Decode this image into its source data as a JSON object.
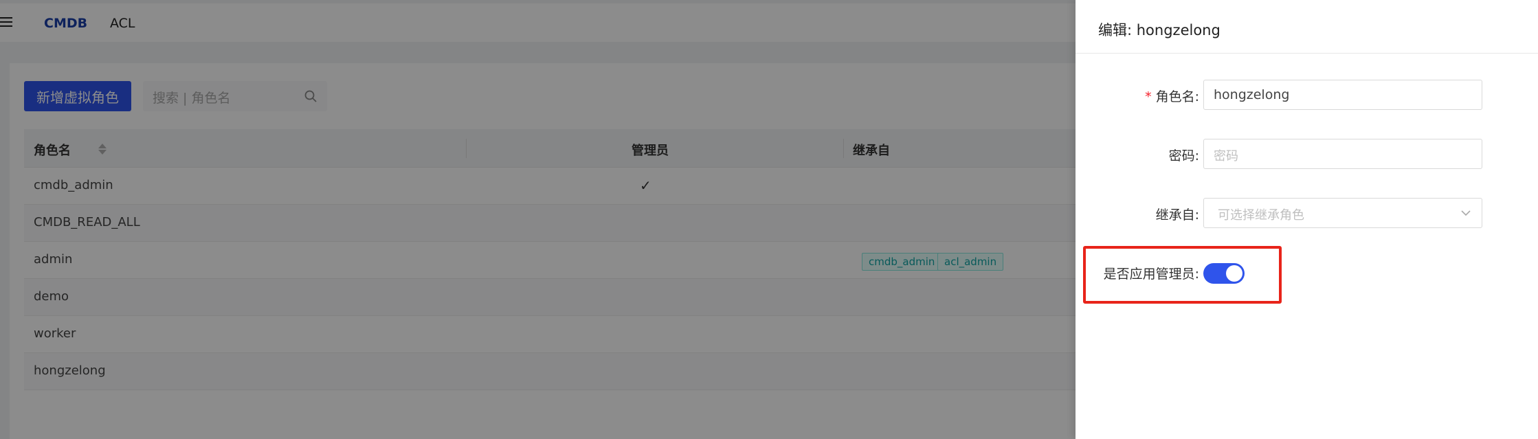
{
  "nav": {
    "items": [
      "CMDB",
      "ACL"
    ]
  },
  "toolbar": {
    "add_button": "新增虚拟角色",
    "search_placeholder": "搜索 | 角色名"
  },
  "table": {
    "headers": {
      "name": "角色名",
      "admin": "管理员",
      "inherit": "继承自"
    },
    "rows": [
      {
        "name": "cmdb_admin",
        "admin": "✓",
        "tags": []
      },
      {
        "name": "CMDB_READ_ALL",
        "admin": "",
        "tags": []
      },
      {
        "name": "admin",
        "admin": "",
        "tags": [
          "cmdb_admin",
          "acl_admin"
        ]
      },
      {
        "name": "demo",
        "admin": "",
        "tags": []
      },
      {
        "name": "worker",
        "admin": "",
        "tags": []
      },
      {
        "name": "hongzelong",
        "admin": "",
        "tags": []
      }
    ]
  },
  "drawer": {
    "title": "编辑: hongzelong",
    "fields": {
      "role_name": {
        "label": "角色名:",
        "value": "hongzelong",
        "required": "*"
      },
      "password": {
        "label": "密码:",
        "placeholder": "密码"
      },
      "inherit": {
        "label": "继承自:",
        "placeholder": "可选择继承角色"
      },
      "app_admin": {
        "label": "是否应用管理员:",
        "enabled": true
      }
    }
  },
  "colors": {
    "primary": "#2f54eb",
    "highlight": "#e8241a",
    "tag": "#10a5a5"
  }
}
